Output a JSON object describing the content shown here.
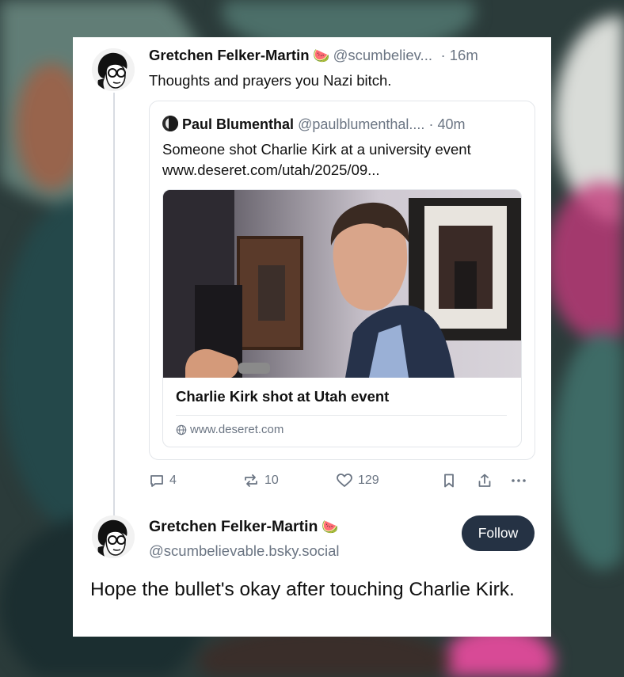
{
  "post": {
    "author_name": "Gretchen Felker-Martin",
    "author_emoji": "🍉",
    "handle": "@scumbeliev...",
    "time": "· 16m",
    "text": "Thoughts and prayers you Nazi bitch."
  },
  "quote": {
    "author_name": "Paul Blumenthal",
    "handle": "@paulblumenthal....",
    "time": "· 40m",
    "text": "Someone shot Charlie Kirk at a university event www.deseret.com/utah/2025/09...",
    "embed": {
      "title": "Charlie Kirk shot at Utah event",
      "domain": "www.deseret.com"
    }
  },
  "actions": {
    "replies": "4",
    "reposts": "10",
    "likes": "129",
    "icons": [
      "reply-icon",
      "repost-icon",
      "like-icon",
      "bookmark-icon",
      "share-icon",
      "more-icon"
    ]
  },
  "reply": {
    "author_name": "Gretchen Felker-Martin",
    "author_emoji": "🍉",
    "handle": "@scumbelievable.bsky.social",
    "follow_label": "Follow",
    "text": "Hope the bullet's okay after touching Charlie Kirk."
  },
  "colors": {
    "follow_button": "#253244",
    "muted_text": "#6b7583",
    "border": "#e3e6ea"
  }
}
